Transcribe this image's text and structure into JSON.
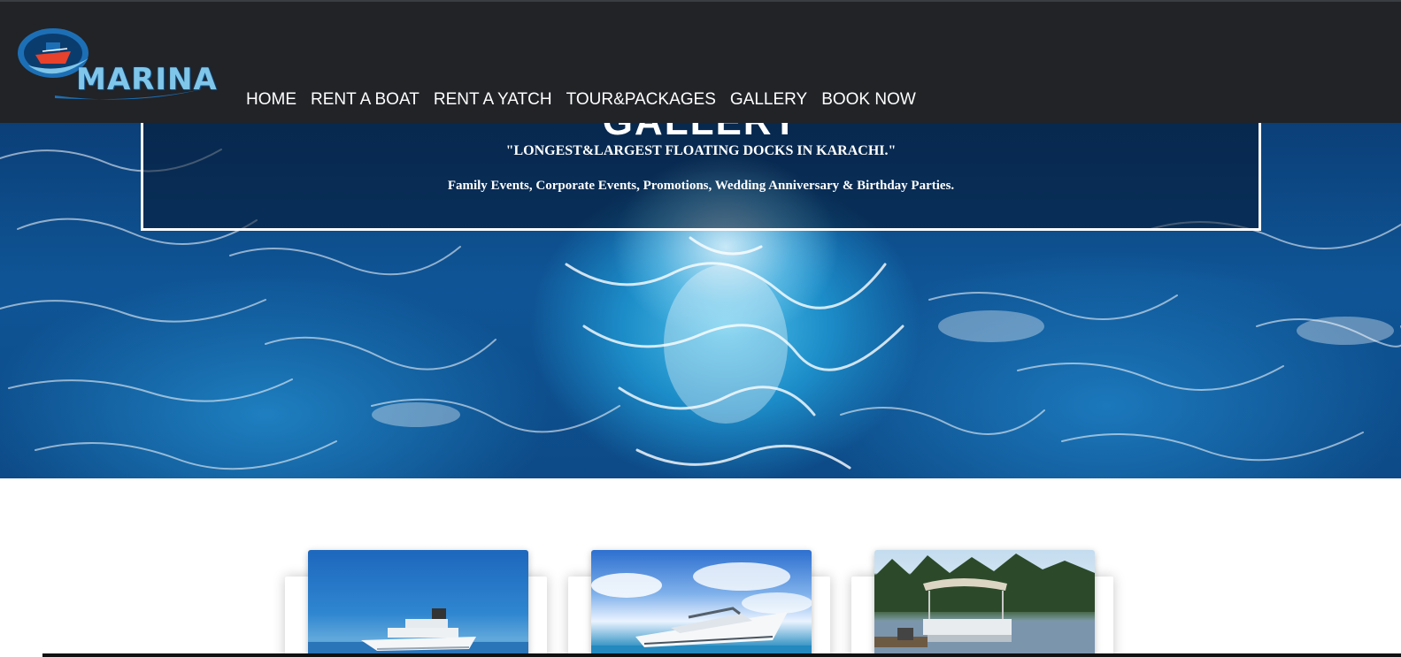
{
  "brand": {
    "name": "MARINA",
    "logo_icon": "ship-in-circle-icon",
    "colors": {
      "header_bg": "#212327",
      "wordmark": "#7fc6ea",
      "emblem_red": "#e8412c",
      "emblem_blue": "#1d6fb5"
    }
  },
  "nav": {
    "items": [
      {
        "label": "HOME"
      },
      {
        "label": "RENT A BOAT"
      },
      {
        "label": "RENT A YATCH"
      },
      {
        "label": "TOUR&PACKAGES"
      },
      {
        "label": "GALLERY"
      },
      {
        "label": "BOOK NOW"
      }
    ]
  },
  "hero": {
    "title": "GALLERY",
    "tagline": "\"LONGEST&LARGEST FLOATING DOCKS IN KARACHI.\"",
    "events": "Family Events, Corporate Events, Promotions, Wedding Anniversary & Birthday Parties."
  },
  "cards": [
    {
      "image": "white superyacht on open blue sea"
    },
    {
      "image": "luxury motor yacht under cloudy sky"
    },
    {
      "image": "pontoon boat at a lakeside dock"
    }
  ]
}
